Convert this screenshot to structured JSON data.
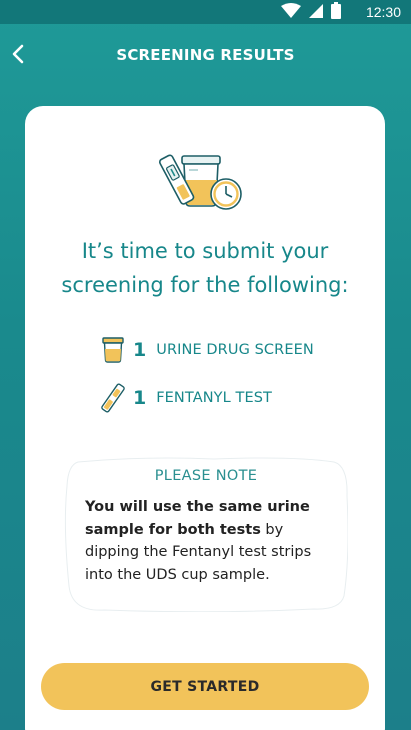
{
  "status_bar": {
    "time": "12:30",
    "icons": [
      "wifi-icon",
      "cellular-signal-icon",
      "battery-icon"
    ]
  },
  "header": {
    "title": "SCREENING RESULTS",
    "back_icon": "chevron-left-icon"
  },
  "card": {
    "headline_line1": "It’s time to submit your",
    "headline_line2": "screening for the following:",
    "items": [
      {
        "icon": "urine-cup-icon",
        "quantity": "1",
        "label": "URINE DRUG SCREEN"
      },
      {
        "icon": "test-strip-icon",
        "quantity": "1",
        "label": "FENTANYL TEST"
      }
    ],
    "note": {
      "title": "PLEASE NOTE",
      "body_bold": "You will use the same urine sample for both tests",
      "body_rest": " by dipping the Fentanyl test strips into the UDS cup sample."
    },
    "cta_label": "GET STARTED"
  },
  "colors": {
    "background_top": "#1f9a98",
    "background_bottom": "#1c7f8a",
    "status_bar": "#127779",
    "accent_teal": "#17878a",
    "cta_yellow": "#f2c35a",
    "note_bg": "#ffffff"
  }
}
